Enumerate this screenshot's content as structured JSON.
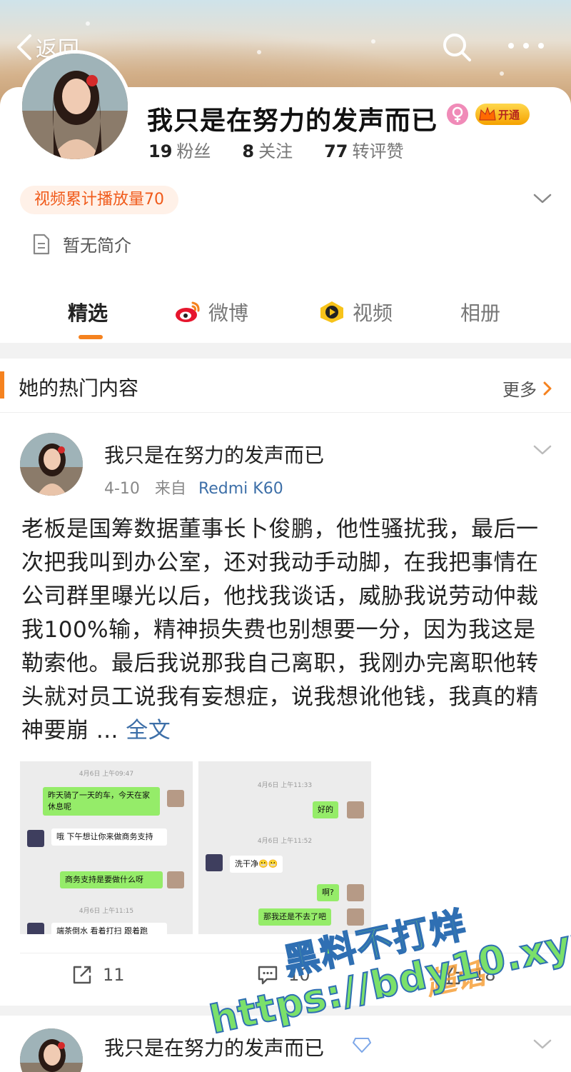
{
  "topbar": {
    "back_label": "返回"
  },
  "profile": {
    "name": "我只是在努力的发声而已",
    "vip_label": "开通",
    "stats": [
      {
        "value": "19",
        "label": "粉丝"
      },
      {
        "value": "8",
        "label": "关注"
      },
      {
        "value": "77",
        "label": "转评赞"
      }
    ],
    "play_count_badge": "视频累计播放量70",
    "intro": "暂无简介"
  },
  "tabs": [
    {
      "label": "精选",
      "icon": "none",
      "active": true
    },
    {
      "label": "微博",
      "icon": "weibo-icon",
      "active": false
    },
    {
      "label": "视频",
      "icon": "video-icon",
      "active": false
    },
    {
      "label": "相册",
      "icon": "none",
      "active": false
    }
  ],
  "hot_section": {
    "title": "她的热门内容",
    "more_label": "更多"
  },
  "post": {
    "author": "我只是在努力的发声而已",
    "date": "4-10",
    "from_label": "来自",
    "device": "Redmi K60",
    "text": "老板是国筹数据董事长卜俊鹏，他性骚扰我，最后一次把我叫到办公室，还对我动手动脚，在我把事情在公司群里曝光以后，他找我谈话，威胁我说劳动仲裁我100%输，精神损失费也别想要一分，因为我这是勒索他。最后我说那我自己离职，我刚办完离职他转头就对员工说我有妄想症，说我想讹他钱，我真的精神要崩 ...",
    "full_text_label": "全文",
    "images": [
      {
        "timestamp_1": "4月6日 上午09:47",
        "msg_1": "昨天骑了一天的车，今天在家休息呢",
        "msg_2": "哦 下午想让你来做商务支持",
        "msg_3": "商务支持是要做什么呀",
        "timestamp_2": "4月6日 上午11:15",
        "msg_4": "端茶倒水 看着打扫 跟着跑"
      },
      {
        "timestamp_1": "4月6日 上午11:33",
        "msg_1": "好的",
        "timestamp_2": "4月6日 上午11:52",
        "msg_2": "洗干净😬😬",
        "msg_3": "啊?",
        "msg_4": "那我还是不去了吧"
      }
    ],
    "actions": {
      "repost": "11",
      "comment": "10",
      "like": "18"
    }
  },
  "post2": {
    "author": "我只是在努力的发声而已"
  },
  "watermark": {
    "line1": "黑料不打烊",
    "line2": "https://bdy10.xyz",
    "tag": "超话"
  },
  "colors": {
    "accent": "#f5821f",
    "link": "#3d6fa8",
    "badge_bg": "#fff1e8",
    "badge_text": "#f05a1a"
  }
}
